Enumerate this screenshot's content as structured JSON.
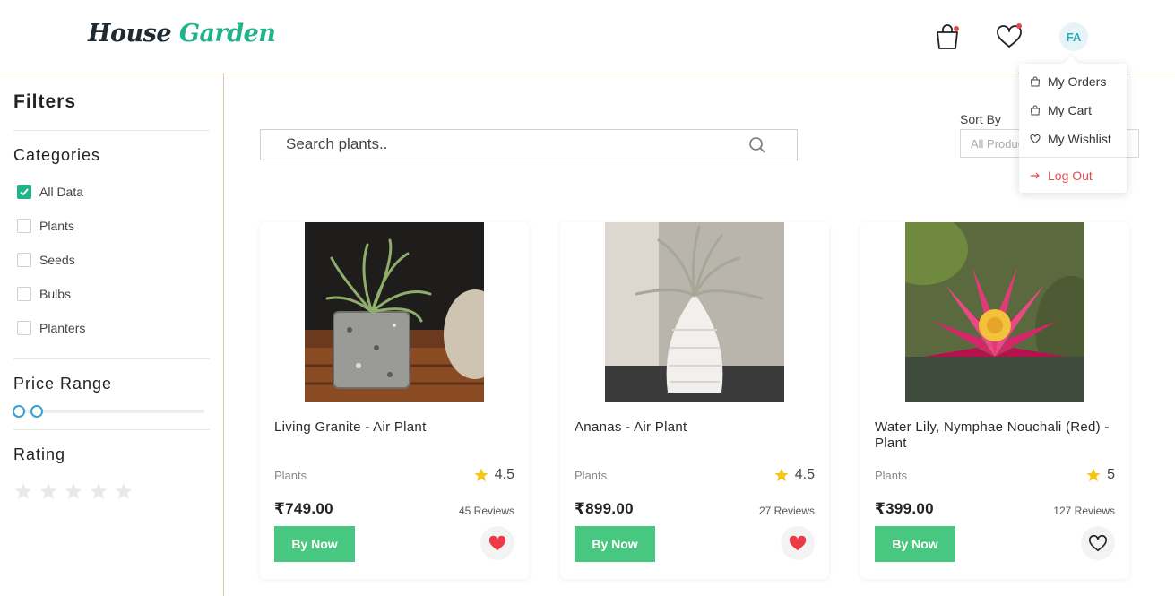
{
  "header": {
    "logo_part1": "House",
    "logo_part2": "Garden",
    "avatar_initials": "FA",
    "colors": {
      "brand_green": "#1fb38a",
      "notification_dot": "#e5484d"
    }
  },
  "sidebar": {
    "title": "Filters",
    "categories_heading": "Categories",
    "categories": [
      {
        "label": "All Data",
        "checked": true
      },
      {
        "label": "Plants",
        "checked": false
      },
      {
        "label": "Seeds",
        "checked": false
      },
      {
        "label": "Bulbs",
        "checked": false
      },
      {
        "label": "Planters",
        "checked": false
      }
    ],
    "price_heading": "Price Range",
    "rating_heading": "Rating"
  },
  "search": {
    "placeholder": "Search plants.."
  },
  "sort": {
    "label": "Sort By",
    "value": "All Products"
  },
  "products": [
    {
      "name": "Living Granite - Air Plant",
      "category": "Plants",
      "rating": "4.5",
      "price": "₹749.00",
      "reviews": "45 Reviews",
      "buy_label": "By Now",
      "wishlisted": true
    },
    {
      "name": "Ananas - Air Plant",
      "category": "Plants",
      "rating": "4.5",
      "price": "₹899.00",
      "reviews": "27 Reviews",
      "buy_label": "By Now",
      "wishlisted": true
    },
    {
      "name": "Water Lily, Nymphae Nouchali (Red) - Plant",
      "category": "Plants",
      "rating": "5",
      "price": "₹399.00",
      "reviews": "127 Reviews",
      "buy_label": "By Now",
      "wishlisted": false
    }
  ],
  "user_menu": {
    "items": [
      {
        "label": "My Orders",
        "icon": "bag-icon"
      },
      {
        "label": "My Cart",
        "icon": "bag-icon"
      },
      {
        "label": "My Wishlist",
        "icon": "heart-icon"
      }
    ],
    "logout_label": "Log Out"
  }
}
